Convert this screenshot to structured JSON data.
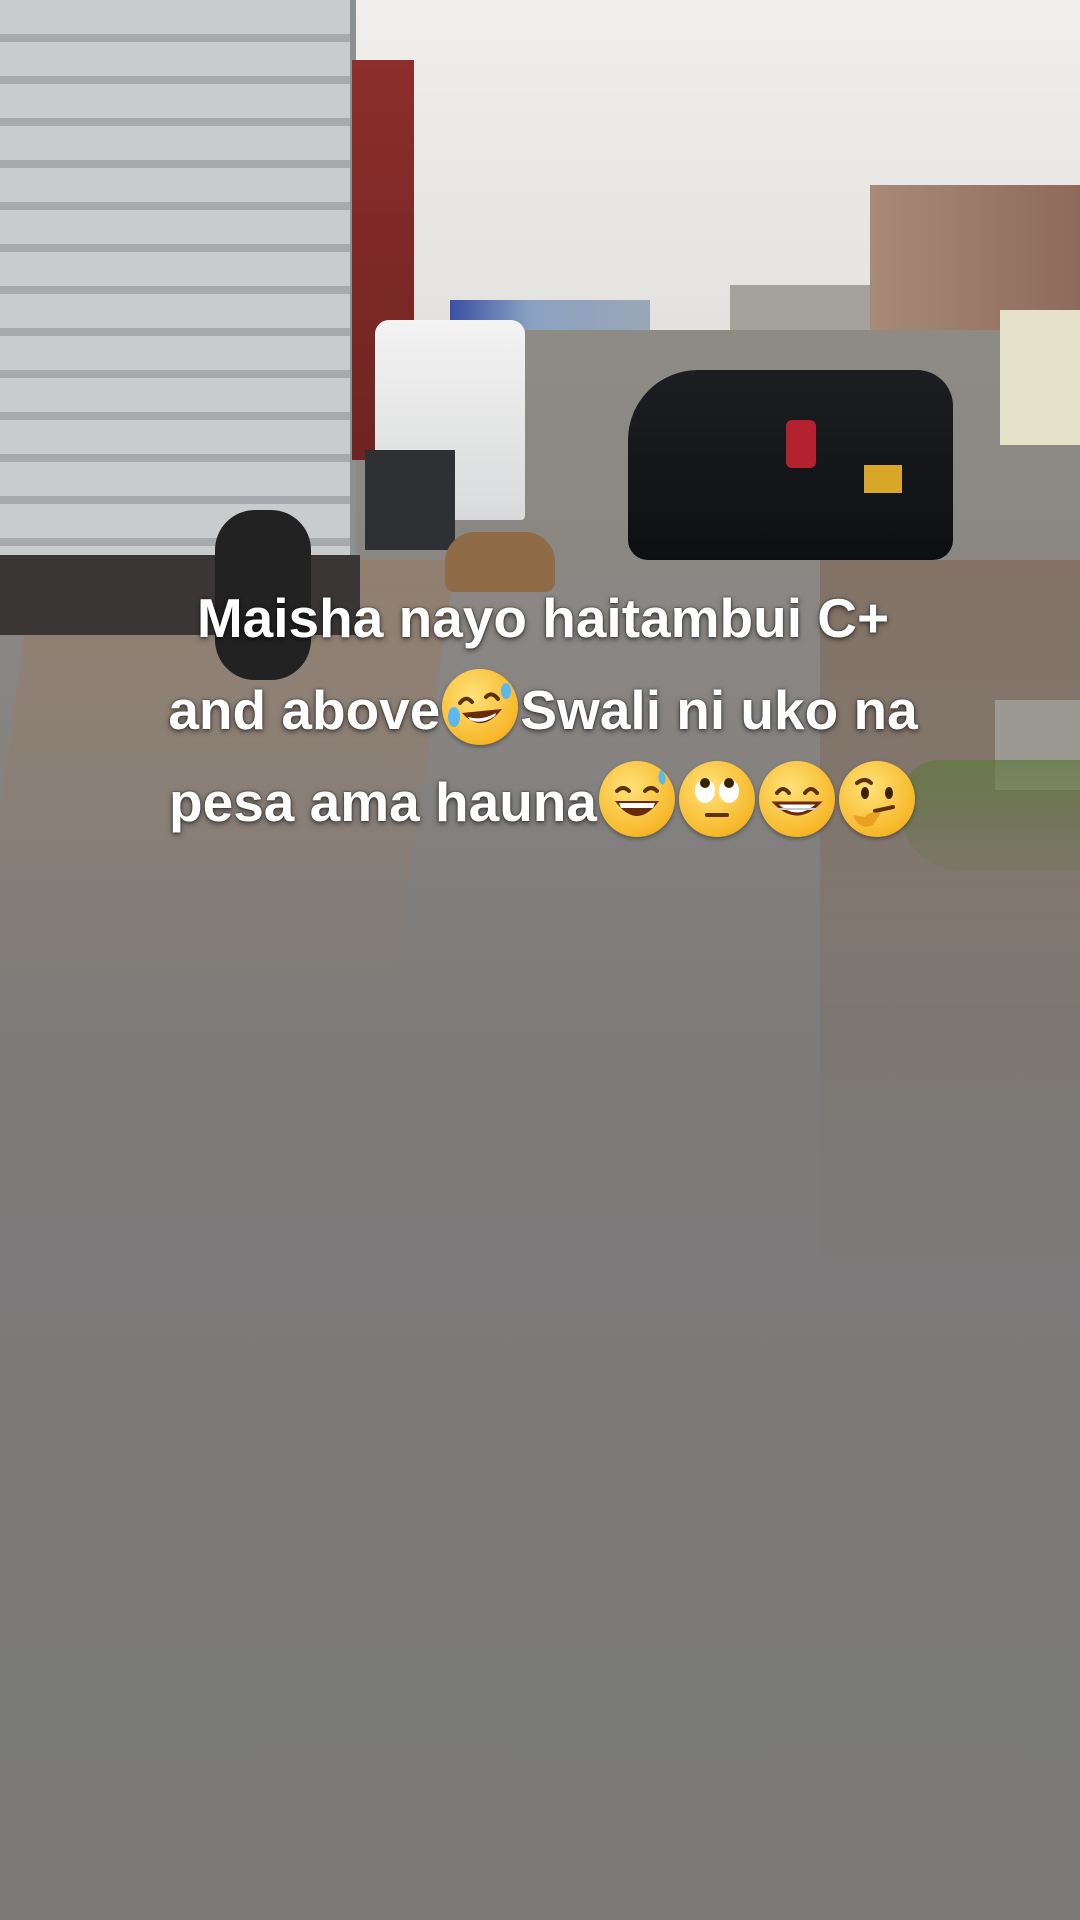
{
  "caption": {
    "line1": "Maisha nayo haitambui C+",
    "line2_a": "and above",
    "line2_b": "Swali ni uko na",
    "line3": "pesa ama hauna"
  },
  "emojis": {
    "laughing": "rolling-on-floor-laughing-emoji",
    "sweat_smile": "grinning-face-with-sweat-emoji",
    "eye_roll": "face-with-rolling-eyes-emoji",
    "grin": "beaming-face-with-smiling-eyes-emoji",
    "thinking": "thinking-face-emoji"
  },
  "colors": {
    "caption_text": "#ffffff",
    "emoji_face": "#f7b82a"
  }
}
